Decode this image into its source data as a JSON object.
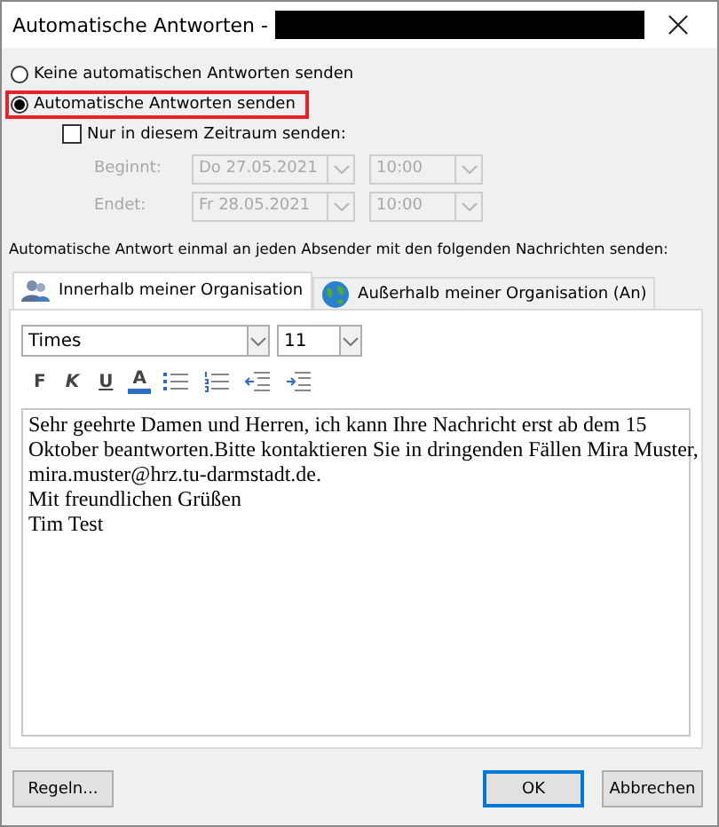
{
  "window": {
    "title": "Automatische Antworten -",
    "redacted": true
  },
  "reply_mode": [
    {
      "label": "Keine automatischen Antworten senden",
      "selected": false,
      "highlighted": false
    },
    {
      "label": "Automatische Antworten senden",
      "selected": true,
      "highlighted": true
    }
  ],
  "time_range": {
    "label": "Nur in diesem Zeitraum senden:",
    "checked": false,
    "disabled": true,
    "rows": [
      {
        "label": "Beginnt:",
        "date": "Do 27.05.2021",
        "time": "10:00"
      },
      {
        "label": "Endet:",
        "date": "Fr 28.05.2021",
        "time": "10:00"
      }
    ]
  },
  "instruction": "Automatische Antwort einmal an jeden Absender mit den folgenden Nachrichten senden:",
  "tabs": [
    {
      "label": "Innerhalb meiner Organisation",
      "selected": true,
      "kind": "people"
    },
    {
      "label": "Außerhalb meiner Organisation (An)",
      "selected": false,
      "kind": "globe"
    }
  ],
  "editor": {
    "font": "Times",
    "size": "11",
    "format_buttons": [
      {
        "kind": "bold",
        "label": "F"
      },
      {
        "kind": "italic",
        "label": "K"
      },
      {
        "kind": "underline",
        "label": "U"
      },
      {
        "kind": "font_color",
        "label": "A"
      },
      {
        "kind": "bullets"
      },
      {
        "kind": "numbering"
      },
      {
        "kind": "outdent"
      },
      {
        "kind": "indent"
      }
    ],
    "lines": [
      "Sehr geehrte Damen und Herren, ich kann Ihre Nachricht erst ab dem 15",
      "Oktober beantworten.Bitte kontaktieren Sie in dringenden Fällen Mira Muster,",
      "mira.muster@hrz.tu-darmstadt.de.",
      "Mit freundlichen Grüßen",
      "Tim Test"
    ]
  },
  "buttons": [
    {
      "label": "Regeln...",
      "default": false
    },
    {
      "label": "OK",
      "default": true
    },
    {
      "label": "Abbrechen",
      "default": false
    }
  ]
}
